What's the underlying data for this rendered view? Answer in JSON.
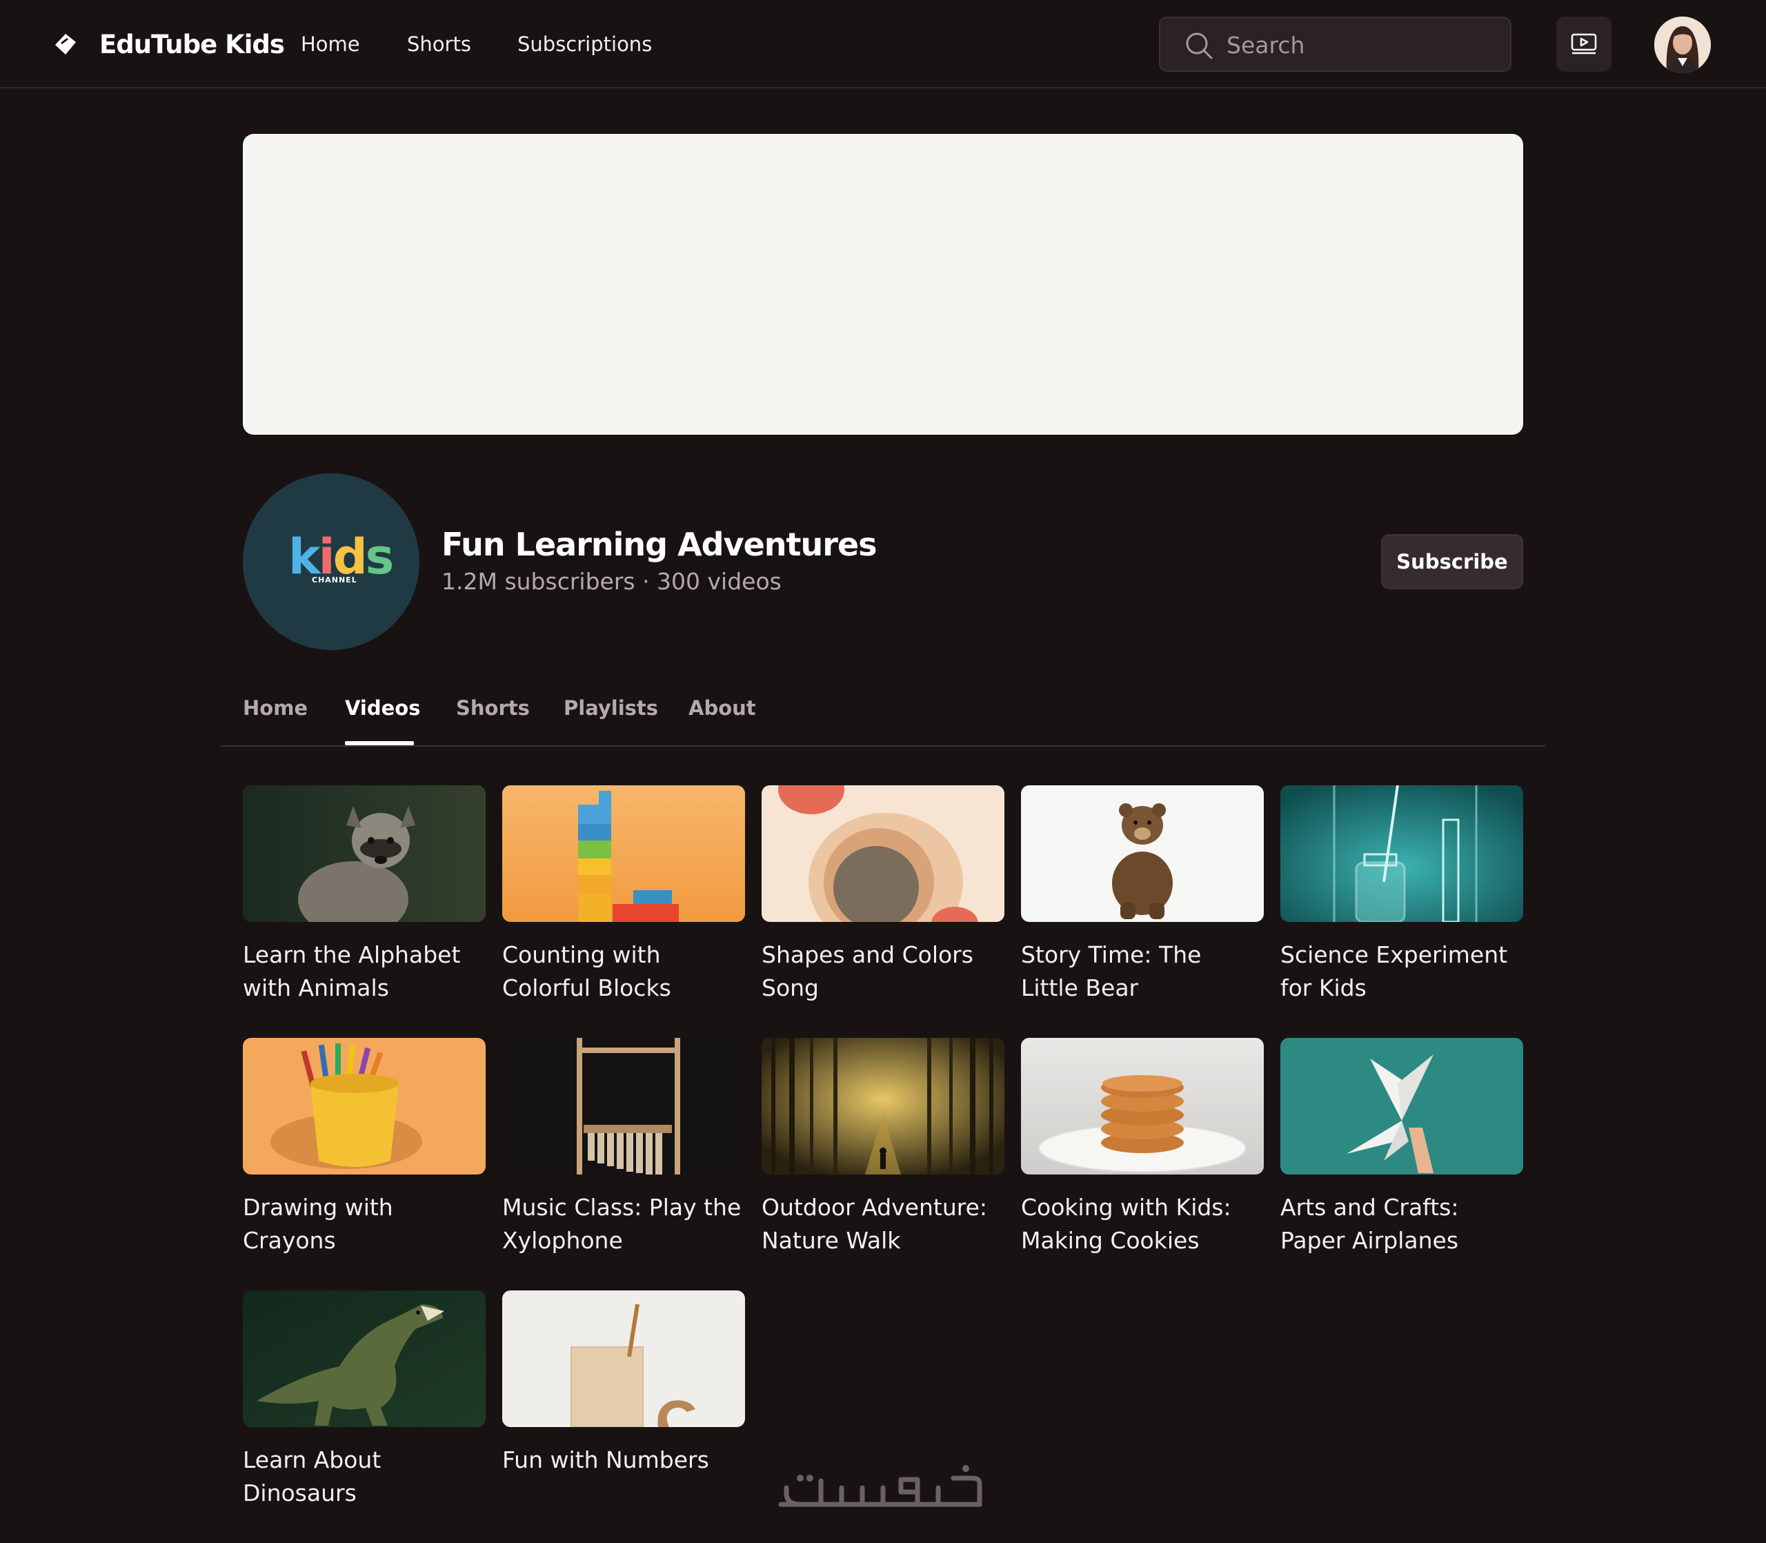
{
  "app": {
    "name": "EduTube Kids",
    "nav": [
      {
        "label": "Home"
      },
      {
        "label": "Shorts"
      },
      {
        "label": "Subscriptions"
      }
    ],
    "search_placeholder": "Search"
  },
  "channel": {
    "logo_word": "kids",
    "logo_subtext": "CHANNEL",
    "name": "Fun Learning Adventures",
    "meta": "1.2M subscribers · 300 videos",
    "subscribe_label": "Subscribe"
  },
  "tabs": [
    {
      "label": "Home",
      "active": false
    },
    {
      "label": "Videos",
      "active": true
    },
    {
      "label": "Shorts",
      "active": false
    },
    {
      "label": "Playlists",
      "active": false
    },
    {
      "label": "About",
      "active": false
    }
  ],
  "videos": [
    {
      "title": "Learn the Alphabet with Animals",
      "thumb_icon": "raccoon-dog-thumbnail"
    },
    {
      "title": "Counting with Colorful Blocks",
      "thumb_icon": "stacked-blocks-thumbnail"
    },
    {
      "title": "Shapes and Colors Song",
      "thumb_icon": "abstract-shapes-thumbnail"
    },
    {
      "title": "Story Time: The Little Bear",
      "thumb_icon": "bear-thumbnail"
    },
    {
      "title": "Science Experiment for Kids",
      "thumb_icon": "lab-glassware-thumbnail"
    },
    {
      "title": "Drawing with Crayons",
      "thumb_icon": "crayon-cup-thumbnail"
    },
    {
      "title": "Music Class: Play the Xylophone",
      "thumb_icon": "xylophone-thumbnail"
    },
    {
      "title": "Outdoor Adventure: Nature Walk",
      "thumb_icon": "forest-path-thumbnail"
    },
    {
      "title": "Cooking with Kids: Making Cookies",
      "thumb_icon": "cookie-stack-thumbnail"
    },
    {
      "title": "Arts and Crafts: Paper Airplanes",
      "thumb_icon": "paper-airplane-thumbnail"
    },
    {
      "title": "Learn About Dinosaurs",
      "thumb_icon": "dinosaur-thumbnail"
    },
    {
      "title": "Fun with Numbers",
      "thumb_icon": "number-cup-thumbnail"
    }
  ],
  "colors": {
    "background": "#181213",
    "surface": "#2b2224",
    "banner": "#f5f6f1",
    "channel_avatar": "#203a44",
    "muted_text": "#b4aaab"
  }
}
